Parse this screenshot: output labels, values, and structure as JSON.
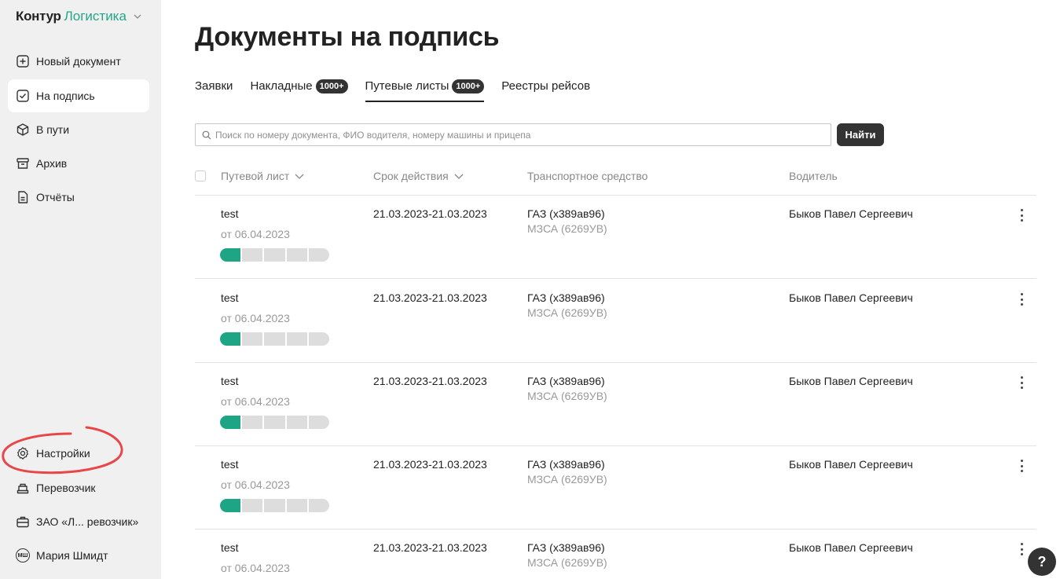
{
  "brand": {
    "name": "Контур",
    "product": "Логистика"
  },
  "sidebar": {
    "items": [
      {
        "label": "Новый документ",
        "icon": "plus-square-icon"
      },
      {
        "label": "На подпись",
        "icon": "check-square-icon",
        "active": true
      },
      {
        "label": "В пути",
        "icon": "cube-icon"
      },
      {
        "label": "Архив",
        "icon": "archive-icon"
      },
      {
        "label": "Отчёты",
        "icon": "report-icon"
      }
    ],
    "bottom": [
      {
        "label": "Настройки",
        "icon": "gear-icon"
      },
      {
        "label": "Перевозчик",
        "icon": "carrier-icon"
      },
      {
        "label": "ЗАО «Л... ревозчик»",
        "icon": "briefcase-icon"
      },
      {
        "label": "Мария Шмидт",
        "icon": "avatar-icon",
        "initials": "МШ"
      }
    ]
  },
  "page": {
    "title": "Документы на подпись"
  },
  "tabs": [
    {
      "label": "Заявки",
      "badge": ""
    },
    {
      "label": "Накладные",
      "badge": "1000+"
    },
    {
      "label": "Путевые листы",
      "badge": "1000+",
      "active": true
    },
    {
      "label": "Реестры рейсов",
      "badge": ""
    }
  ],
  "search": {
    "placeholder": "Поиск по номеру документа, ФИО водителя, номеру машины и прицепа",
    "value": "",
    "button": "Найти"
  },
  "table": {
    "columns": [
      "Путевой лист",
      "Срок действия",
      "Транспортное средство",
      "Водитель"
    ],
    "rows": [
      {
        "doc": "test",
        "date": "от 06.04.2023",
        "period": "21.03.2023-21.03.2023",
        "vehicle": "ГАЗ (х389ав96)",
        "trailer": "МЗСА (6269УВ)",
        "driver": "Быков Павел Сергеевич",
        "progress_steps_done": 1,
        "progress_steps_total": 5
      },
      {
        "doc": "test",
        "date": "от 06.04.2023",
        "period": "21.03.2023-21.03.2023",
        "vehicle": "ГАЗ (х389ав96)",
        "trailer": "МЗСА (6269УВ)",
        "driver": "Быков Павел Сергеевич",
        "progress_steps_done": 1,
        "progress_steps_total": 5
      },
      {
        "doc": "test",
        "date": "от 06.04.2023",
        "period": "21.03.2023-21.03.2023",
        "vehicle": "ГАЗ (х389ав96)",
        "trailer": "МЗСА (6269УВ)",
        "driver": "Быков Павел Сергеевич",
        "progress_steps_done": 1,
        "progress_steps_total": 5
      },
      {
        "doc": "test",
        "date": "от 06.04.2023",
        "period": "21.03.2023-21.03.2023",
        "vehicle": "ГАЗ (х389ав96)",
        "trailer": "МЗСА (6269УВ)",
        "driver": "Быков Павел Сергеевич",
        "progress_steps_done": 1,
        "progress_steps_total": 5
      },
      {
        "doc": "test",
        "date": "от 06.04.2023",
        "period": "21.03.2023-21.03.2023",
        "vehicle": "ГАЗ (х389ав96)",
        "trailer": "МЗСА (6269УВ)",
        "driver": "Быков Павел Сергеевич"
      }
    ]
  },
  "help": {
    "label": "?"
  },
  "colors": {
    "accent": "#1ea586",
    "brand_green": "#23a68a",
    "annotation": "#e8474a",
    "dark": "#333333"
  }
}
